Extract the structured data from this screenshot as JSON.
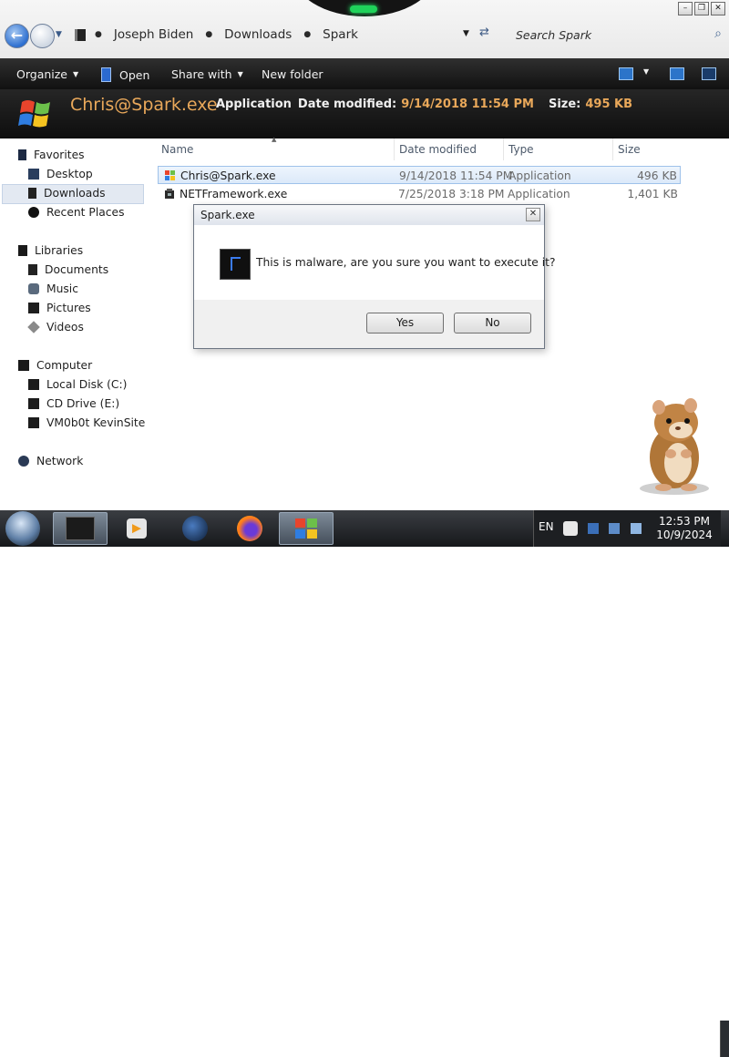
{
  "address": {
    "path": [
      "Joseph Biden",
      "Downloads",
      "Spark"
    ],
    "search_placeholder": "Search Spark"
  },
  "toolbar": {
    "organize": "Organize",
    "open": "Open",
    "share_with": "Share with",
    "new_folder": "New folder"
  },
  "details_pane": {
    "name": "Chris@Spark.exe",
    "type": "Application",
    "date_label": "Date modified:",
    "date_value": "9/14/2018 11:54 PM",
    "size_label": "Size:",
    "size_value": "495 KB"
  },
  "nav": {
    "favorites": "Favorites",
    "desktop": "Desktop",
    "downloads": "Downloads",
    "recent_places": "Recent Places",
    "libraries": "Libraries",
    "documents": "Documents",
    "music": "Music",
    "pictures": "Pictures",
    "videos": "Videos",
    "computer": "Computer",
    "local_disk": "Local Disk (C:)",
    "cd_drive": "CD Drive (E:)",
    "network_share": "VM0b0t KevinSite",
    "network": "Network"
  },
  "columns": {
    "name": "Name",
    "date": "Date modified",
    "type": "Type",
    "size": "Size"
  },
  "files": [
    {
      "name": "Chris@Spark.exe",
      "date": "9/14/2018 11:54 PM",
      "type": "Application",
      "size": "496 KB",
      "selected": true
    },
    {
      "name": "NETFramework.exe",
      "date": "7/25/2018 3:18 PM",
      "type": "Application",
      "size": "1,401 KB",
      "selected": false
    }
  ],
  "dialog": {
    "title": "Spark.exe",
    "message": "This is malware, are you sure you want to execute it?",
    "yes": "Yes",
    "no": "No"
  },
  "tray": {
    "language": "EN",
    "time": "12:53 PM",
    "date": "10/9/2024"
  },
  "colors": {
    "accent_orange": "#e9a85a",
    "toolbar_dark": "#1c1c1c",
    "selection_blue": "#dbe9f9"
  }
}
